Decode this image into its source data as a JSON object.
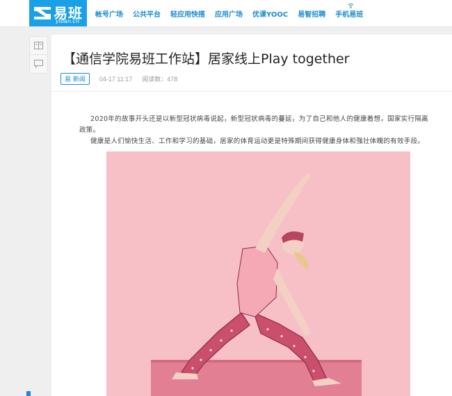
{
  "header": {
    "logo_text": "易班",
    "logo_sub": "yiban.cn",
    "nav": [
      "帐号广场",
      "公共平台",
      "轻应用快搭",
      "应用广场",
      "优课YOOC",
      "易智招聘",
      "手机易班"
    ]
  },
  "article": {
    "title": "【通信学院易班工作站】居家线上Play together",
    "tag": "易 新闻",
    "date": "04-17 11:17",
    "read_label": "阅读数：",
    "read_count": "478",
    "paragraphs": [
      "2020年的故事开头还是以新型冠状病毒说起，新型冠状病毒的蔓延，为了自己和他人的健康着想，国家实行隔离政策。",
      "健康是人们愉快生活、工作和学习的基础，居家的体育运动更是特殊期间获得健康身体和强壮体魄的有效手段。"
    ]
  },
  "colors": {
    "brand": "#1aa0e6",
    "nav_text": "#1a8bd2",
    "illustration_bg": "#f7c0c6"
  }
}
